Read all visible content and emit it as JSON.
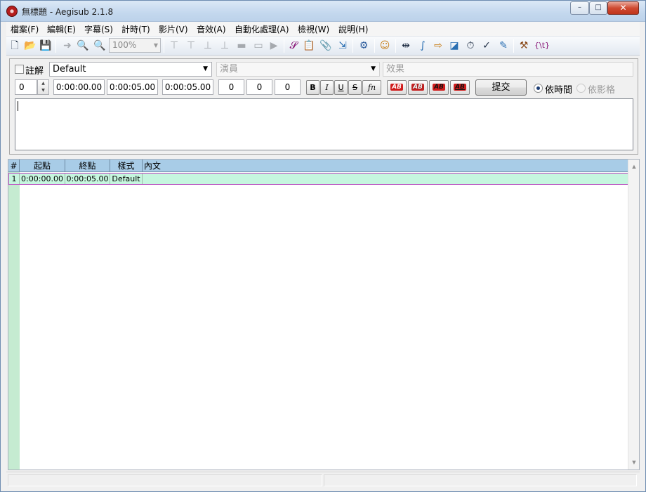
{
  "window": {
    "title": "無標題 - Aegisub 2.1.8",
    "minimize": "–",
    "maximize": "□",
    "close": "✕"
  },
  "menu": [
    "檔案(F)",
    "編輯(E)",
    "字幕(S)",
    "計時(T)",
    "影片(V)",
    "音效(A)",
    "自動化處理(A)",
    "檢視(W)",
    "說明(H)"
  ],
  "toolbar": {
    "zoom": "100%",
    "icons": [
      "new-file-icon",
      "open-folder-icon",
      "save-icon",
      "jump-to-icon",
      "zoom-in-icon",
      "zoom-out-icon",
      "snap-start-icon",
      "snap-end-icon",
      "snap-scene-icon",
      "snap-frame-icon",
      "snap-video-icon",
      "video-frame-icon",
      "video-camera-icon",
      "styles-manager-icon",
      "properties-icon",
      "attachments-icon",
      "fonts-collector-icon",
      "automation-icon",
      "resample-icon",
      "timing-post-processor-icon",
      "kanji-timer-icon",
      "shift-times-icon",
      "translation-assistant-icon",
      "timer-icon",
      "spell-check-icon",
      "assistant-icon",
      "options-icon",
      "tags-icon"
    ]
  },
  "editor": {
    "comment_label": "註解",
    "style_value": "Default",
    "actor_placeholder": "演員",
    "effect_placeholder": "效果",
    "layer": "0",
    "start_time": "0:00:00.00",
    "end_time": "0:00:05.00",
    "duration": "0:00:05.00",
    "margin_left": "0",
    "margin_right": "0",
    "margin_vertical": "0",
    "bold": "B",
    "italic": "I",
    "underline": "U",
    "strikeout": "S",
    "font": "fn",
    "color_labels": [
      "AB",
      "AB",
      "AB",
      "AB"
    ],
    "commit_label": "提交",
    "by_time_label": "依時間",
    "by_frame_label": "依影格",
    "text": ""
  },
  "grid": {
    "headers": [
      "#",
      "起點",
      "終點",
      "樣式",
      "內文"
    ],
    "rows": [
      {
        "num": "1",
        "start": "0:00:00.00",
        "end": "0:00:05.00",
        "style": "Default",
        "text": ""
      }
    ]
  },
  "status": {
    "left": "",
    "right": ""
  }
}
